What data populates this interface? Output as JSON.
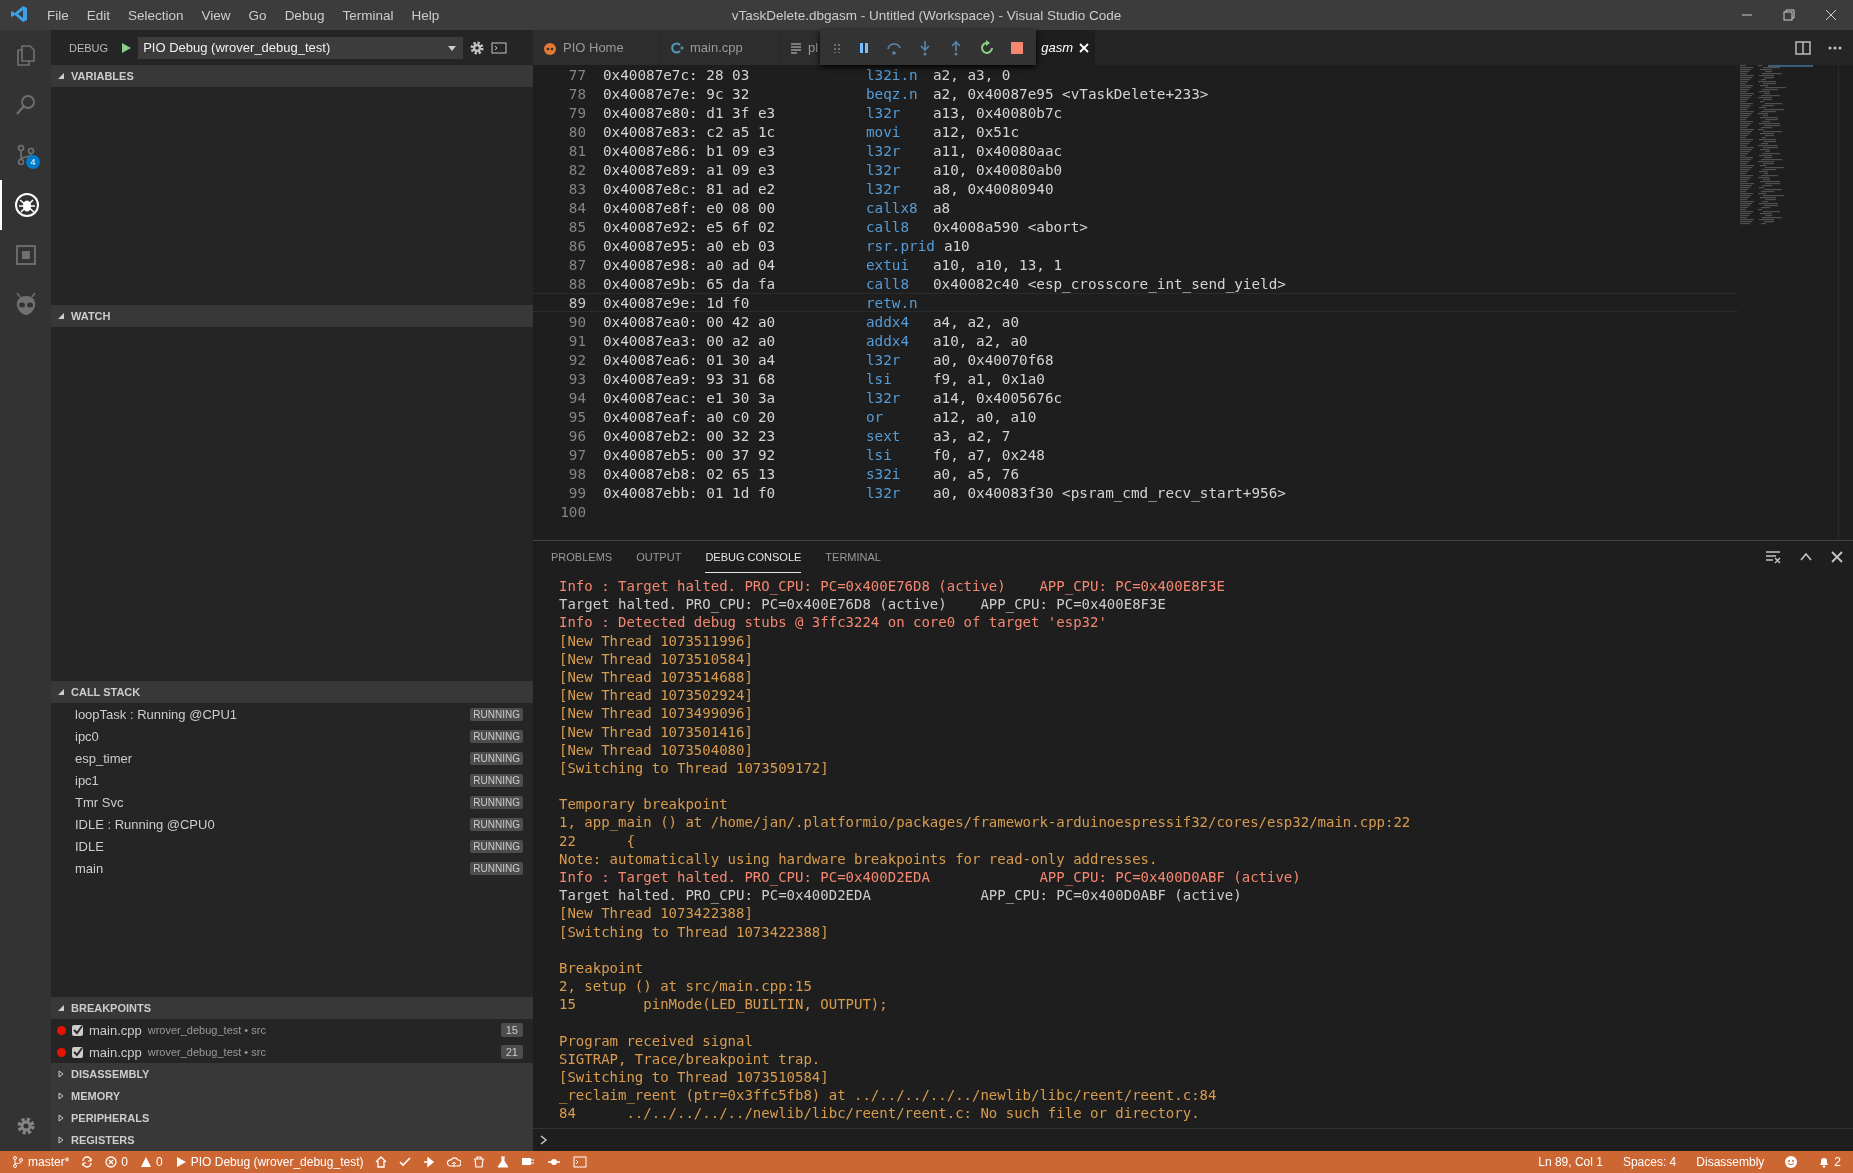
{
  "window": {
    "title": "vTaskDelete.dbgasm - Untitled (Workspace) - Visual Studio Code"
  },
  "menu": [
    "File",
    "Edit",
    "Selection",
    "View",
    "Go",
    "Debug",
    "Terminal",
    "Help"
  ],
  "activity_bar": {
    "items": [
      {
        "kind": "files",
        "selected": false
      },
      {
        "kind": "search",
        "selected": false
      },
      {
        "kind": "source_control",
        "selected": false,
        "badge": "4"
      },
      {
        "kind": "debug",
        "selected": true
      },
      {
        "kind": "extensions",
        "selected": false
      },
      {
        "kind": "platformio",
        "selected": false
      }
    ]
  },
  "sidebar": {
    "title": "DEBUG",
    "configuration": "PIO Debug (wrover_debug_test)",
    "sections": [
      {
        "title": "VARIABLES",
        "kind": "empty",
        "expanded": true
      },
      {
        "title": "WATCH",
        "kind": "empty",
        "expanded": true
      },
      {
        "title": "CALL STACK",
        "kind": "threads",
        "expanded": true,
        "items": [
          {
            "name": "loopTask : Running @CPU1",
            "state": "RUNNING"
          },
          {
            "name": "ipc0",
            "state": "RUNNING"
          },
          {
            "name": "esp_timer",
            "state": "RUNNING"
          },
          {
            "name": "ipc1",
            "state": "RUNNING"
          },
          {
            "name": "Tmr Svc",
            "state": "RUNNING"
          },
          {
            "name": "IDLE : Running @CPU0",
            "state": "RUNNING"
          },
          {
            "name": "IDLE",
            "state": "RUNNING"
          },
          {
            "name": "main",
            "state": "RUNNING"
          }
        ]
      },
      {
        "title": "BREAKPOINTS",
        "kind": "breakpoints",
        "expanded": true,
        "items": [
          {
            "file": "main.cpp",
            "path": "wrover_debug_test • src",
            "line": "15",
            "checked": true
          },
          {
            "file": "main.cpp",
            "path": "wrover_debug_test • src",
            "line": "21",
            "checked": true
          }
        ]
      },
      {
        "title": "DISASSEMBLY",
        "kind": "empty",
        "expanded": false
      },
      {
        "title": "MEMORY",
        "kind": "empty",
        "expanded": false
      },
      {
        "title": "PERIPHERALS",
        "kind": "empty",
        "expanded": false
      },
      {
        "title": "REGISTERS",
        "kind": "empty",
        "expanded": false
      }
    ]
  },
  "editor": {
    "tabs": [
      {
        "label": "PIO Home",
        "kind": "pio",
        "selected": false,
        "preview": false
      },
      {
        "label": "main.cpp",
        "kind": "cpp",
        "selected": false,
        "preview": false
      },
      {
        "label": "pl",
        "kind": "text",
        "selected": false,
        "preview": false
      },
      {
        "label": "gasm",
        "kind": "hidden",
        "selected": true,
        "preview": true
      }
    ],
    "debug_toolbar": [
      {
        "kind": "grip"
      },
      {
        "kind": "pause"
      },
      {
        "kind": "step_over"
      },
      {
        "kind": "step_into"
      },
      {
        "kind": "step_out"
      },
      {
        "kind": "restart"
      },
      {
        "kind": "stop"
      }
    ],
    "lines": [
      {
        "number": "77",
        "address": "0x40087e7c:",
        "bytes": "28 03",
        "op": "l32i.n",
        "args": "a2, a3, 0",
        "current": false
      },
      {
        "number": "78",
        "address": "0x40087e7e:",
        "bytes": "9c 32",
        "op": "beqz.n",
        "args": "a2, 0x40087e95 <vTaskDelete+233>",
        "current": false
      },
      {
        "number": "79",
        "address": "0x40087e80:",
        "bytes": "d1 3f e3",
        "op": "l32r",
        "args": "a13, 0x40080b7c",
        "current": false
      },
      {
        "number": "80",
        "address": "0x40087e83:",
        "bytes": "c2 a5 1c",
        "op": "movi",
        "args": "a12, 0x51c",
        "current": false
      },
      {
        "number": "81",
        "address": "0x40087e86:",
        "bytes": "b1 09 e3",
        "op": "l32r",
        "args": "a11, 0x40080aac",
        "current": false
      },
      {
        "number": "82",
        "address": "0x40087e89:",
        "bytes": "a1 09 e3",
        "op": "l32r",
        "args": "a10, 0x40080ab0",
        "current": false
      },
      {
        "number": "83",
        "address": "0x40087e8c:",
        "bytes": "81 ad e2",
        "op": "l32r",
        "args": "a8, 0x40080940",
        "current": false
      },
      {
        "number": "84",
        "address": "0x40087e8f:",
        "bytes": "e0 08 00",
        "op": "callx8",
        "args": "a8",
        "current": false
      },
      {
        "number": "85",
        "address": "0x40087e92:",
        "bytes": "e5 6f 02",
        "op": "call8",
        "args": "0x4008a590 <abort>",
        "current": false
      },
      {
        "number": "86",
        "address": "0x40087e95:",
        "bytes": "a0 eb 03",
        "op": "rsr.prid",
        "args": "a10",
        "current": false
      },
      {
        "number": "87",
        "address": "0x40087e98:",
        "bytes": "a0 ad 04",
        "op": "extui",
        "args": "a10, a10, 13, 1",
        "current": false
      },
      {
        "number": "88",
        "address": "0x40087e9b:",
        "bytes": "65 da fa",
        "op": "call8",
        "args": "0x40082c40 <esp_crosscore_int_send_yield>",
        "current": false
      },
      {
        "number": "89",
        "address": "0x40087e9e:",
        "bytes": "1d f0",
        "op": "retw.n",
        "current": true
      },
      {
        "number": "90",
        "address": "0x40087ea0:",
        "bytes": "00 42 a0",
        "op": "addx4",
        "args": "a4, a2, a0",
        "current": false
      },
      {
        "number": "91",
        "address": "0x40087ea3:",
        "bytes": "00 a2 a0",
        "op": "addx4",
        "args": "a10, a2, a0",
        "current": false
      },
      {
        "number": "92",
        "address": "0x40087ea6:",
        "bytes": "01 30 a4",
        "op": "l32r",
        "args": "a0, 0x40070f68",
        "current": false
      },
      {
        "number": "93",
        "address": "0x40087ea9:",
        "bytes": "93 31 68",
        "op": "lsi",
        "args": "f9, a1, 0x1a0",
        "current": false
      },
      {
        "number": "94",
        "address": "0x40087eac:",
        "bytes": "e1 30 3a",
        "op": "l32r",
        "args": "a14, 0x4005676c",
        "current": false
      },
      {
        "number": "95",
        "address": "0x40087eaf:",
        "bytes": "a0 c0 20",
        "op": "or",
        "args": "a12, a0, a10",
        "current": false
      },
      {
        "number": "96",
        "address": "0x40087eb2:",
        "bytes": "00 32 23",
        "op": "sext",
        "args": "a3, a2, 7",
        "current": false
      },
      {
        "number": "97",
        "address": "0x40087eb5:",
        "bytes": "00 37 92",
        "op": "lsi",
        "args": "f0, a7, 0x248",
        "current": false
      },
      {
        "number": "98",
        "address": "0x40087eb8:",
        "bytes": "02 65 13",
        "op": "s32i",
        "args": "a0, a5, 76",
        "current": false
      },
      {
        "number": "99",
        "address": "0x40087ebb:",
        "bytes": "01 1d f0",
        "op": "l32r",
        "args": "a0, 0x40083f30 <psram_cmd_recv_start+956>",
        "current": false
      },
      {
        "number": "100",
        "current": false
      }
    ]
  },
  "panel": {
    "tabs": [
      {
        "label": "PROBLEMS",
        "selected": false
      },
      {
        "label": "OUTPUT",
        "selected": false
      },
      {
        "label": "DEBUG CONSOLE",
        "selected": true
      },
      {
        "label": "TERMINAL",
        "selected": false
      }
    ],
    "console": [
      {
        "kind": "info",
        "text": "Info : Target halted. PRO_CPU: PC=0x400E76D8 (active)    APP_CPU: PC=0x400E8F3E"
      },
      {
        "kind": "plain",
        "text": "Target halted. PRO_CPU: PC=0x400E76D8 (active)    APP_CPU: PC=0x400E8F3E"
      },
      {
        "kind": "info",
        "text": "Info : Detected debug stubs @ 3ffc3224 on core0 of target 'esp32'"
      },
      {
        "kind": "log",
        "text": "[New Thread 1073511996]"
      },
      {
        "kind": "log",
        "text": "[New Thread 1073510584]"
      },
      {
        "kind": "log",
        "text": "[New Thread 1073514688]"
      },
      {
        "kind": "log",
        "text": "[New Thread 1073502924]"
      },
      {
        "kind": "log",
        "text": "[New Thread 1073499096]"
      },
      {
        "kind": "log",
        "text": "[New Thread 1073501416]"
      },
      {
        "kind": "log",
        "text": "[New Thread 1073504080]"
      },
      {
        "kind": "log",
        "text": "[Switching to Thread 1073509172]"
      },
      {
        "kind": "gap"
      },
      {
        "kind": "log",
        "text": "Temporary breakpoint"
      },
      {
        "kind": "log",
        "text": "1, app_main () at /home/jan/.platformio/packages/framework-arduinoespressif32/cores/esp32/main.cpp:22"
      },
      {
        "kind": "log",
        "text": "22      {"
      },
      {
        "kind": "log",
        "text": "Note: automatically using hardware breakpoints for read-only addresses."
      },
      {
        "kind": "info",
        "text": "Info : Target halted. PRO_CPU: PC=0x400D2EDA             APP_CPU: PC=0x400D0ABF (active)"
      },
      {
        "kind": "plain",
        "text": "Target halted. PRO_CPU: PC=0x400D2EDA             APP_CPU: PC=0x400D0ABF (active)"
      },
      {
        "kind": "log",
        "text": "[New Thread 1073422388]"
      },
      {
        "kind": "log",
        "text": "[Switching to Thread 1073422388]"
      },
      {
        "kind": "gap"
      },
      {
        "kind": "log",
        "text": "Breakpoint"
      },
      {
        "kind": "log",
        "text": "2, setup () at src/main.cpp:15"
      },
      {
        "kind": "log",
        "text": "15        pinMode(LED_BUILTIN, OUTPUT);"
      },
      {
        "kind": "gap"
      },
      {
        "kind": "log",
        "text": "Program received signal"
      },
      {
        "kind": "log",
        "text": "SIGTRAP, Trace/breakpoint trap."
      },
      {
        "kind": "log",
        "text": "[Switching to Thread 1073510584]"
      },
      {
        "kind": "log",
        "text": "_reclaim_reent (ptr=0x3ffc5fb8) at ../../../../../newlib/libc/reent/reent.c:84"
      },
      {
        "kind": "log",
        "text": "84      ../../../../../newlib/libc/reent/reent.c: No such file or directory."
      }
    ]
  },
  "status_bar": {
    "left": [
      {
        "kind": "branch",
        "text": "master*"
      },
      {
        "kind": "sync"
      },
      {
        "kind": "errors",
        "text": "0"
      },
      {
        "kind": "warnings",
        "text": "0"
      },
      {
        "kind": "debug",
        "text": "PIO Debug (wrover_debug_test)"
      },
      {
        "kind": "home"
      },
      {
        "kind": "check"
      },
      {
        "kind": "arrow"
      },
      {
        "kind": "upload"
      },
      {
        "kind": "trash"
      },
      {
        "kind": "flask"
      },
      {
        "kind": "serial"
      },
      {
        "kind": "plug"
      },
      {
        "kind": "terminal"
      }
    ],
    "right": [
      {
        "kind": "label",
        "text": "Ln 89, Col 1"
      },
      {
        "kind": "label",
        "text": "Spaces: 4"
      },
      {
        "kind": "label",
        "text": "Disassembly"
      },
      {
        "kind": "smiley"
      },
      {
        "kind": "bell",
        "text": "2"
      }
    ]
  }
}
